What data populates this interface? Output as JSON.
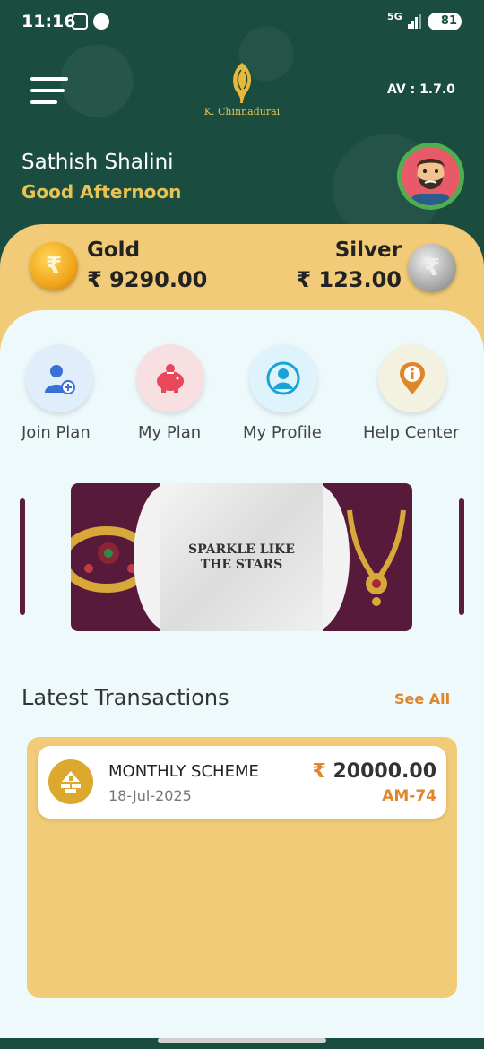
{
  "status_bar": {
    "time": "11:16",
    "network": "5G",
    "battery": "81",
    "icons": [
      "screenshot-icon",
      "app-notification-icon",
      "signal-icon",
      "battery-icon"
    ]
  },
  "header": {
    "brand": "K. Chinnadurai",
    "version": "AV : 1.7.0",
    "icons": [
      "menu-icon",
      "peacock-feather-logo"
    ]
  },
  "user": {
    "name": "Sathish Shalini",
    "greeting": "Good Afternoon"
  },
  "balances": {
    "gold_label": "Gold",
    "gold_value": "₹ 9290.00",
    "silver_label": "Silver",
    "silver_value": "₹ 123.00",
    "coin_symbol": "₹"
  },
  "quick_actions": [
    {
      "label": "Join Plan",
      "icon": "add-user-icon"
    },
    {
      "label": "My Plan",
      "icon": "piggy-bank-icon"
    },
    {
      "label": "My Profile",
      "icon": "profile-icon"
    },
    {
      "label": "Help Center",
      "icon": "info-pin-icon"
    }
  ],
  "banner": {
    "tagline_line1": "SPARKLE LIKE",
    "tagline_line2": "THE STARS"
  },
  "transactions": {
    "title": "Latest Transactions",
    "see_all": "See All",
    "items": [
      {
        "name": "MONTHLY SCHEME",
        "date": "18-Jul-2025",
        "currency": "₹",
        "amount": "20000.00",
        "id": "AM-74"
      }
    ]
  },
  "colors": {
    "primary_green": "#1a4d40",
    "gold_accent": "#e8c252",
    "panel_gold": "#f1cb77",
    "orange_accent": "#e0852a"
  }
}
